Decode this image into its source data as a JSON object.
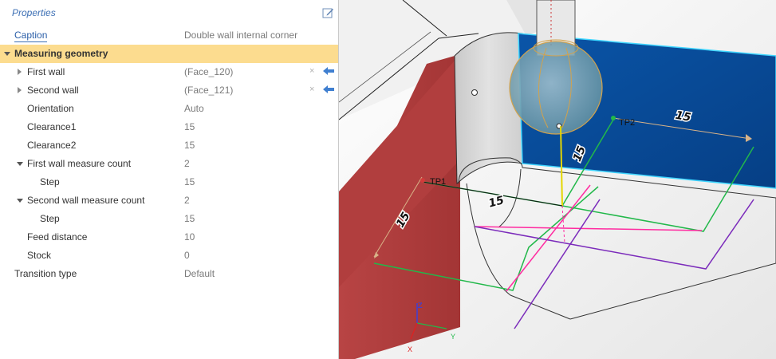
{
  "panel": {
    "title": "Properties",
    "caption": {
      "label": "Caption",
      "value": "Double wall internal corner"
    },
    "section": {
      "label": "Measuring geometry"
    },
    "rows": [
      {
        "label": "First wall",
        "value": "(Face_120)"
      },
      {
        "label": "Second wall",
        "value": "(Face_121)"
      },
      {
        "label": "Orientation",
        "value": "Auto"
      },
      {
        "label": "Clearance1",
        "value": "15"
      },
      {
        "label": "Clearance2",
        "value": "15"
      },
      {
        "label": "First wall measure count",
        "value": "2"
      },
      {
        "label": "Step",
        "value": "15"
      },
      {
        "label": "Second wall measure count",
        "value": "2"
      },
      {
        "label": "Step",
        "value": "15"
      },
      {
        "label": "Feed distance",
        "value": "10"
      },
      {
        "label": "Stock",
        "value": "0"
      },
      {
        "label": "Transition type",
        "value": "Default"
      }
    ],
    "clear_glyph": "×"
  },
  "viewport": {
    "dims": {
      "d1": "15",
      "d2": "15",
      "d3": "15",
      "d4": "15"
    },
    "points": {
      "tp1": "TP1",
      "tp2": "TP2"
    },
    "axes": {
      "x": "X",
      "y": "Y",
      "z": "Z"
    }
  },
  "colors": {
    "accent": "#3c6fb4",
    "section": "#fcdc8f",
    "wall_red": "#b34040",
    "wall_blue": "#0a4fa2"
  }
}
